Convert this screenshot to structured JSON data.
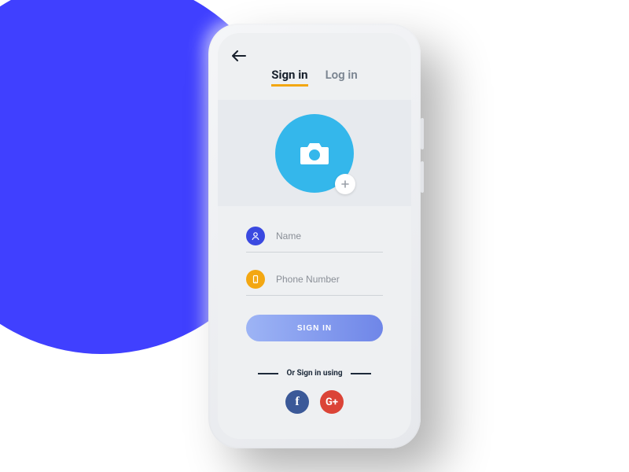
{
  "tabs": {
    "signin": "Sign in",
    "login": "Log in"
  },
  "fields": {
    "name_placeholder": "Name",
    "phone_placeholder": "Phone Number"
  },
  "buttons": {
    "submit": "SIGN IN"
  },
  "divider": "Or Sign in using",
  "social": {
    "facebook_glyph": "f",
    "google_glyph": "G+"
  },
  "icons": {
    "back": "back-arrow-icon",
    "avatar": "camera-icon",
    "avatar_add": "plus-icon",
    "name": "user-icon",
    "phone": "phone-icon"
  },
  "colors": {
    "bg_circle": "#4040ff",
    "avatar": "#34b7eb",
    "accent_blue": "#3a49e0",
    "accent_orange": "#f3a712",
    "facebook": "#3b5998",
    "google": "#db4437"
  }
}
